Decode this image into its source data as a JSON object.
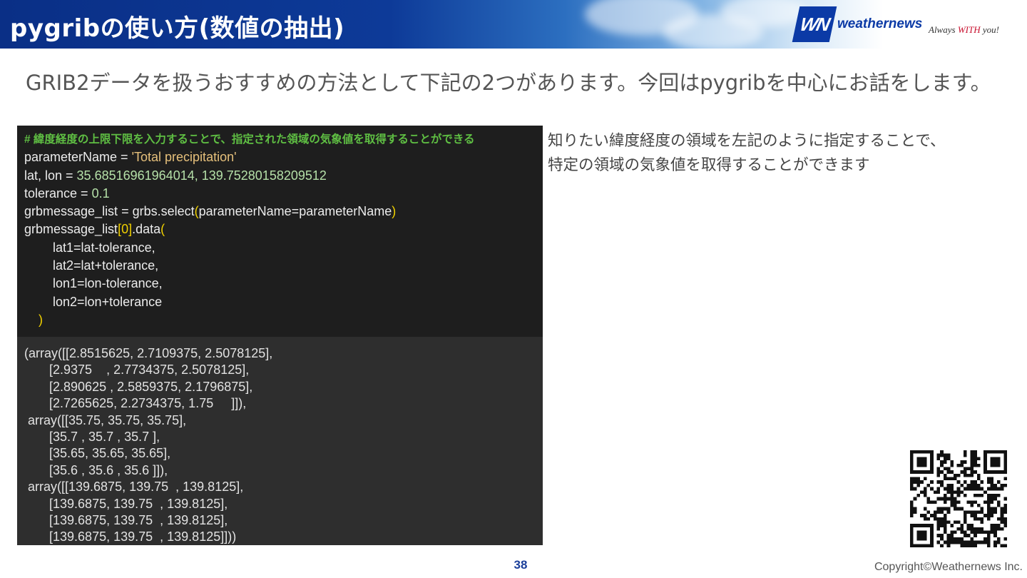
{
  "header": {
    "title": "pygribの使い方(数値の抽出)",
    "logo_mark": "WN",
    "logo_word": "weathernews",
    "tagline_prefix": "Always ",
    "tagline_emphasis": "WITH",
    "tagline_suffix": " you!"
  },
  "lead_text": "GRIB2データを扱うおすすめの方法として下記の2つがあります。今回はpygribを中心にお話をします。",
  "code": {
    "comment": "# 緯度経度の上限下限を入力することで、指定された領域の気象値を取得することができる",
    "line1_prefix": "parameterName = ",
    "line1_string": "'Total precipitation'",
    "line2_prefix": "lat, lon = ",
    "line2_values": "35.68516961964014, 139.75280158209512",
    "line3_prefix": "tolerance = ",
    "line3_value": "0.1",
    "line4_prefix": "grbmessage_list = grbs.select",
    "line4_open": "(",
    "line4_args": "parameterName=parameterName",
    "line4_close": ")",
    "line5_prefix": "grbmessage_list",
    "line5_index": "[0]",
    "line5_mid": ".data",
    "line5_open": "(",
    "line6": "        lat1=lat-tolerance,",
    "line7": "        lat2=lat+tolerance,",
    "line8": "        lon1=lon-tolerance,",
    "line9": "        lon2=lon+tolerance",
    "line10": "    )"
  },
  "output": [
    "(array([[2.8515625, 2.7109375, 2.5078125],",
    "       [2.9375    , 2.7734375, 2.5078125],",
    "       [2.890625 , 2.5859375, 2.1796875],",
    "       [2.7265625, 2.2734375, 1.75     ]]),",
    " array([[35.75, 35.75, 35.75],",
    "       [35.7 , 35.7 , 35.7 ],",
    "       [35.65, 35.65, 35.65],",
    "       [35.6 , 35.6 , 35.6 ]]),",
    " array([[139.6875, 139.75  , 139.8125],",
    "       [139.6875, 139.75  , 139.8125],",
    "       [139.6875, 139.75  , 139.8125],",
    "       [139.6875, 139.75  , 139.8125]]))"
  ],
  "note_line1": "知りたい緯度経度の領域を左記のように指定することで、",
  "note_line2": "特定の領域の気象値を取得することができます",
  "page_number": "38",
  "copyright": "Copyright©Weathernews Inc.",
  "colors": {
    "header_dark": "#0a2f86",
    "brand_blue": "#0b3aa6",
    "code_bg": "#1e1e1e",
    "output_bg": "#2e2e2e",
    "comment_green": "#5fbf43"
  }
}
